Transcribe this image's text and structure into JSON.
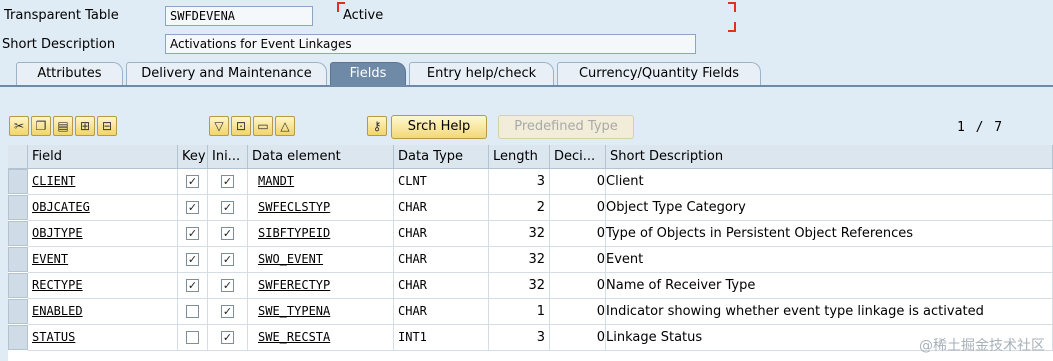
{
  "header": {
    "table_type_label": "Transparent Table",
    "table_name": "SWFDEVENA",
    "status": "Active",
    "short_desc_label": "Short Description",
    "short_desc_value": "Activations for Event Linkages"
  },
  "tabs": [
    {
      "label": "Attributes",
      "active": false
    },
    {
      "label": "Delivery and Maintenance",
      "active": false
    },
    {
      "label": "Fields",
      "active": true
    },
    {
      "label": "Entry help/check",
      "active": false
    },
    {
      "label": "Currency/Quantity Fields",
      "active": false
    }
  ],
  "toolbar": {
    "search_help_label": "Srch Help",
    "predefined_type_label": "Predefined Type",
    "page_indicator": "1 / 7",
    "icons": [
      "cut-icon",
      "copy-icon",
      "paste-icon",
      "insert-row-icon",
      "delete-row-icon",
      "sort-down-icon",
      "select-all-icon",
      "deselect-icon",
      "sort-up-icon",
      "key-icon"
    ]
  },
  "table": {
    "columns": [
      "Field",
      "Key",
      "Ini...",
      "Data element",
      "Data Type",
      "Length",
      "Deci...",
      "Short Description"
    ],
    "rows": [
      {
        "field": "CLIENT",
        "key": true,
        "initial": true,
        "data_element": "MANDT",
        "data_type": "CLNT",
        "length": "3",
        "decimals": "0",
        "short_desc": "Client"
      },
      {
        "field": "OBJCATEG",
        "key": true,
        "initial": true,
        "data_element": "SWFECLSTYP",
        "data_type": "CHAR",
        "length": "2",
        "decimals": "0",
        "short_desc": "Object Type Category"
      },
      {
        "field": "OBJTYPE",
        "key": true,
        "initial": true,
        "data_element": "SIBFTYPEID",
        "data_type": "CHAR",
        "length": "32",
        "decimals": "0",
        "short_desc": "Type of Objects in Persistent Object References"
      },
      {
        "field": "EVENT",
        "key": true,
        "initial": true,
        "data_element": "SWO_EVENT",
        "data_type": "CHAR",
        "length": "32",
        "decimals": "0",
        "short_desc": "Event"
      },
      {
        "field": "RECTYPE",
        "key": true,
        "initial": true,
        "data_element": "SWFERECTYP",
        "data_type": "CHAR",
        "length": "32",
        "decimals": "0",
        "short_desc": "Name of Receiver Type"
      },
      {
        "field": "ENABLED",
        "key": false,
        "initial": true,
        "data_element": "SWE_TYPENA",
        "data_type": "CHAR",
        "length": "1",
        "decimals": "0",
        "short_desc": "Indicator showing whether event type linkage is activated"
      },
      {
        "field": "STATUS",
        "key": false,
        "initial": true,
        "data_element": "SWE_RECSTA",
        "data_type": "INT1",
        "length": "3",
        "decimals": "0",
        "short_desc": "Linkage Status"
      }
    ]
  },
  "watermark": "@稀土掘金技术社区",
  "colors": {
    "active_tab": "#6f8aa7",
    "background": "#dfebf5",
    "button": "#f3d877",
    "status_bracket": "#e0301e"
  }
}
